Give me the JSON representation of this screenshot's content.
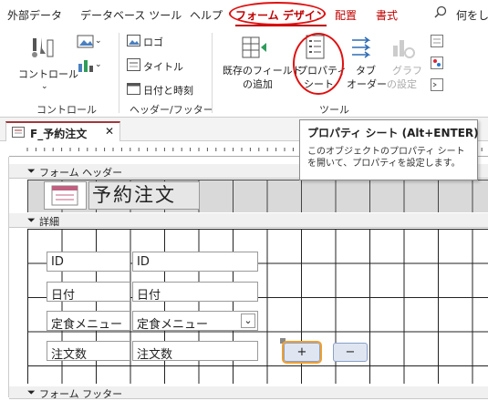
{
  "ribbon_tabs": [
    {
      "label": "外部データ"
    },
    {
      "label": "データベース ツール"
    },
    {
      "label": "ヘルプ"
    },
    {
      "label": "フォーム デザイン"
    },
    {
      "label": "配置"
    },
    {
      "label": "書式"
    },
    {
      "label": "何をし"
    }
  ],
  "ribbon": {
    "controls_btn": "コントロール",
    "controls_group": "コントロール",
    "logo": "ロゴ",
    "title": "タイトル",
    "datetime": "日付と時刻",
    "header_group": "ヘッダー/フッター",
    "add_existing_line1": "既存のフィールド",
    "add_existing_line2": "の追加",
    "property_line1": "プロパティ",
    "property_line2": "シート",
    "tab_line1": "タブ",
    "tab_line2": "オーダー",
    "chart_line1": "グラフ",
    "chart_line2": "の設定",
    "tools_group": "ツール"
  },
  "document_tab": {
    "label": "F_予約注文"
  },
  "sections": {
    "form_header": "フォーム ヘッダー",
    "detail": "詳細",
    "form_footer": "フォーム フッター"
  },
  "form": {
    "title": "予約注文",
    "fields": [
      {
        "label": "ID",
        "value": "ID"
      },
      {
        "label": "日付",
        "value": "日付"
      },
      {
        "label": "定食メニュー",
        "value": "定食メニュー"
      },
      {
        "label": "注文数",
        "value": "注文数"
      }
    ],
    "plus_button": "+",
    "minus_button": "−"
  },
  "tooltip": {
    "title": "プロパティ シート (Alt+ENTER)",
    "description": "このオブジェクトのプロパティ シートを開いて、プロパティを設定します。"
  },
  "colors": {
    "accent_red": "#c00000",
    "annotation_red": "#e01010",
    "selection_orange": "#f0a030"
  }
}
